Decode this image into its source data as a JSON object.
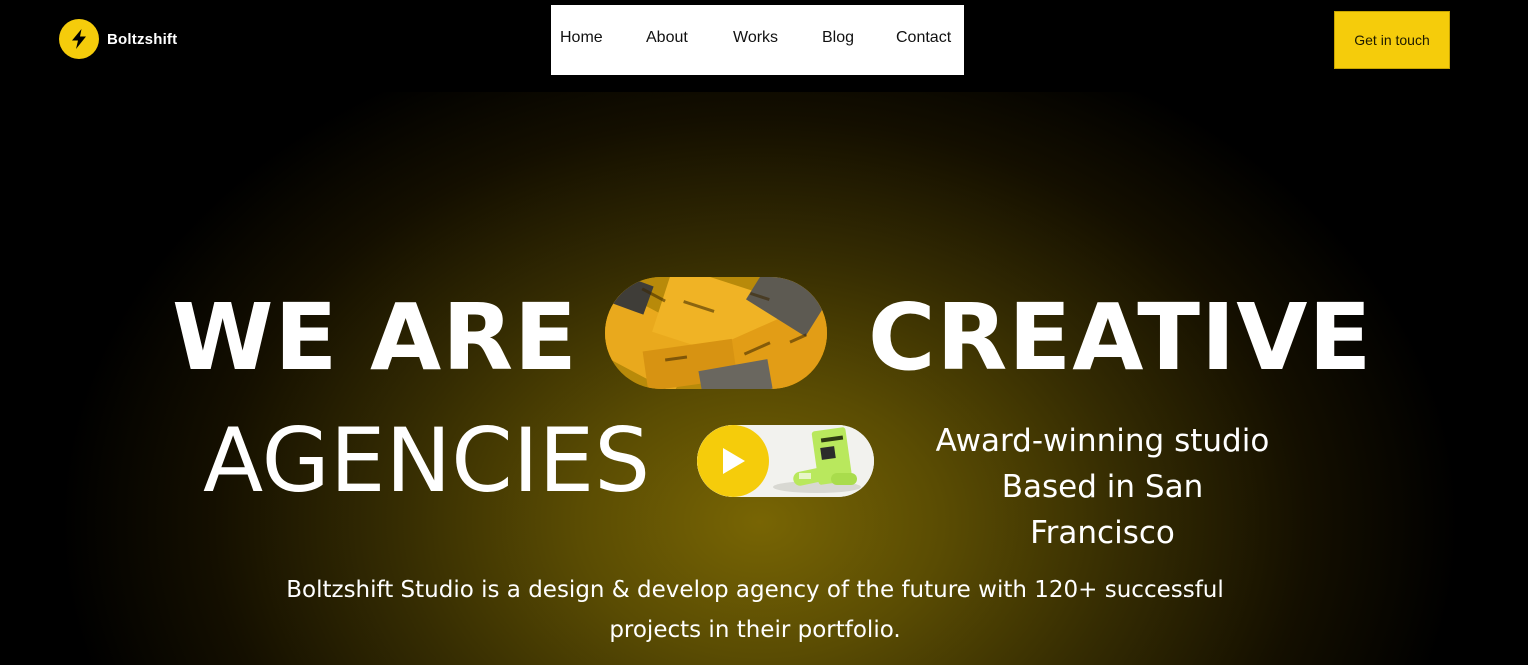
{
  "brand": {
    "name": "Boltzshift",
    "logo_icon": "lightning-bolt-icon",
    "accent_color": "#f5cc0b"
  },
  "nav": {
    "items": [
      {
        "label": "Home"
      },
      {
        "label": "About"
      },
      {
        "label": "Works"
      },
      {
        "label": "Blog"
      },
      {
        "label": "Contact"
      }
    ]
  },
  "cta": {
    "label": "Get in touch"
  },
  "hero": {
    "headline": {
      "word1": "WE",
      "word2": "ARE",
      "word3": "CREATIVE",
      "word4": "AGENCIES"
    },
    "tagline": {
      "line1": "Award-winning studio",
      "line2": "Based in San Francisco"
    },
    "description": {
      "line1": "Boltzshift Studio is a design & develop agency of the future with 120+ successful",
      "line2": "projects in their portfolio."
    },
    "play_icon": "play-icon"
  }
}
